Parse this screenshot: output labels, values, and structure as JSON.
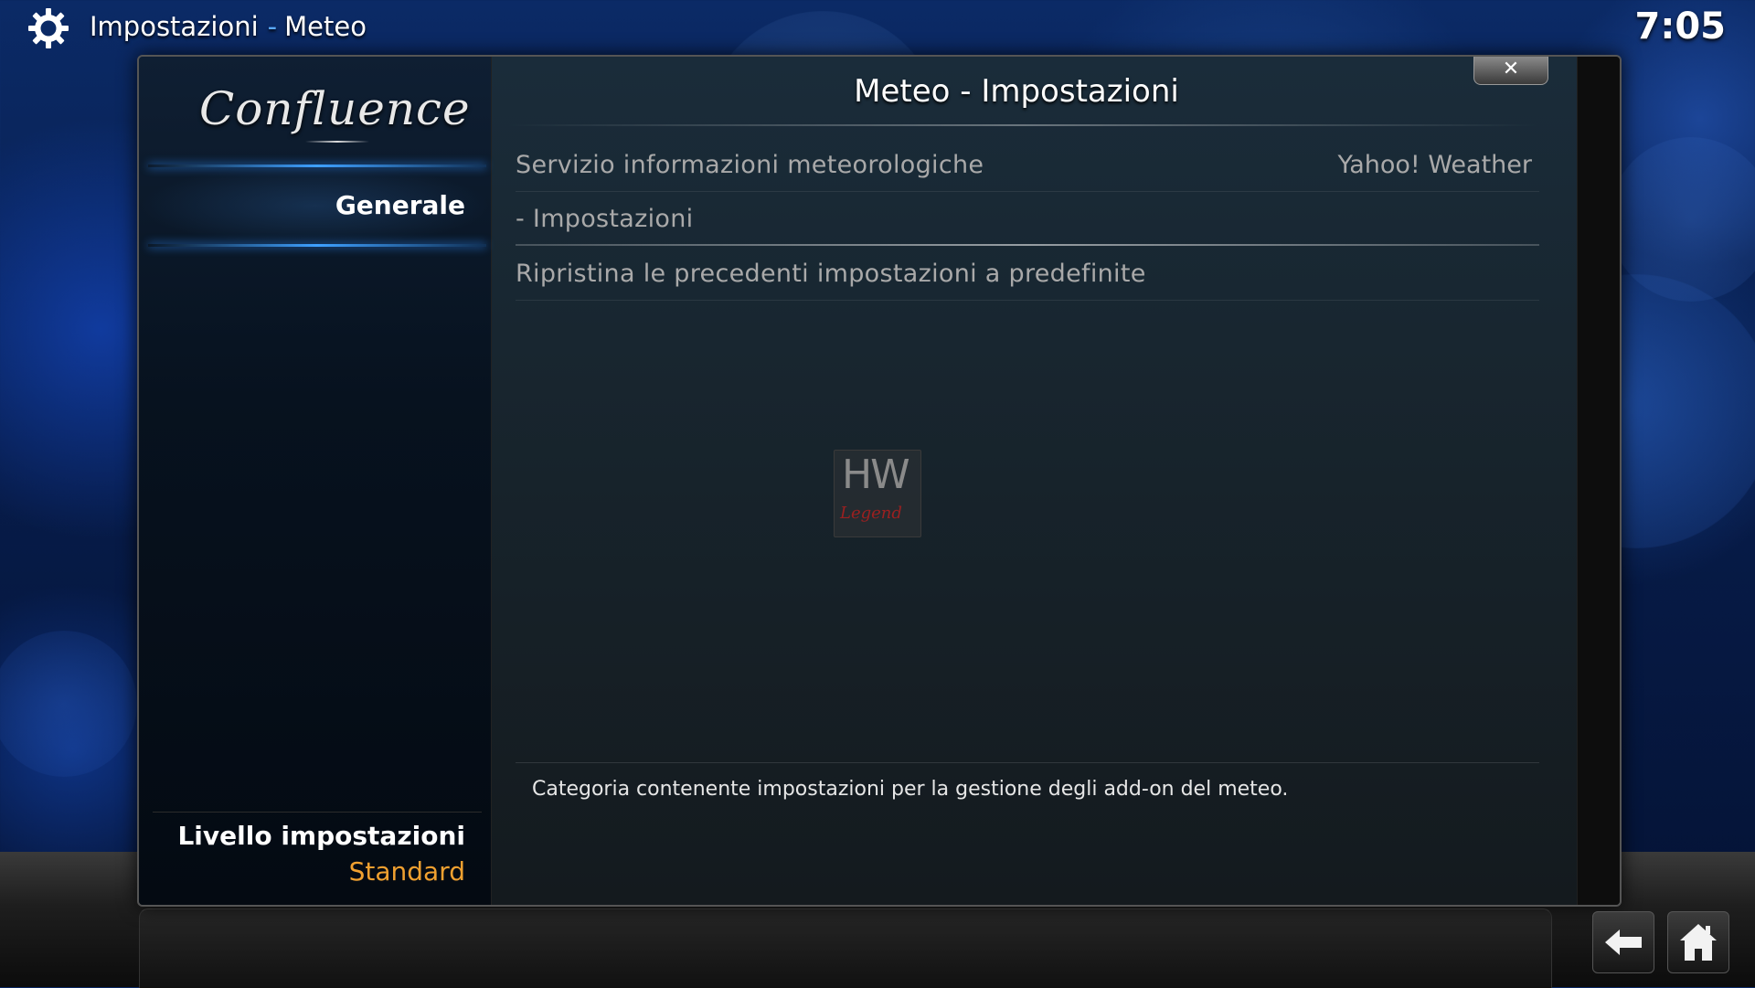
{
  "header": {
    "section": "Impostazioni",
    "separator": "-",
    "page": "Meteo",
    "clock": "7:05"
  },
  "sidebar": {
    "logo_text": "Confluence",
    "items": [
      {
        "label": "Generale",
        "selected": true
      }
    ],
    "settings_level": {
      "title": "Livello impostazioni",
      "value": "Standard",
      "value_color": "#f0a030"
    }
  },
  "dialog": {
    "title": "Meteo - Impostazioni",
    "close_icon": "close-icon",
    "settings": [
      {
        "label": "Servizio informazioni meteorologiche",
        "value": "Yahoo! Weather"
      },
      {
        "label": "- Impostazioni",
        "value": ""
      },
      {
        "label": "Ripristina le precedenti impostazioni a predefinite",
        "value": ""
      }
    ],
    "description": "Categoria contenente impostazioni per la gestione degli add-on del meteo."
  },
  "watermark": {
    "top": "HW",
    "bottom": "Legend"
  },
  "footer": {
    "back_icon": "back-arrow-icon",
    "home_icon": "home-icon"
  },
  "colors": {
    "accent": "#3ea0ff",
    "highlight_value": "#f0a030"
  }
}
